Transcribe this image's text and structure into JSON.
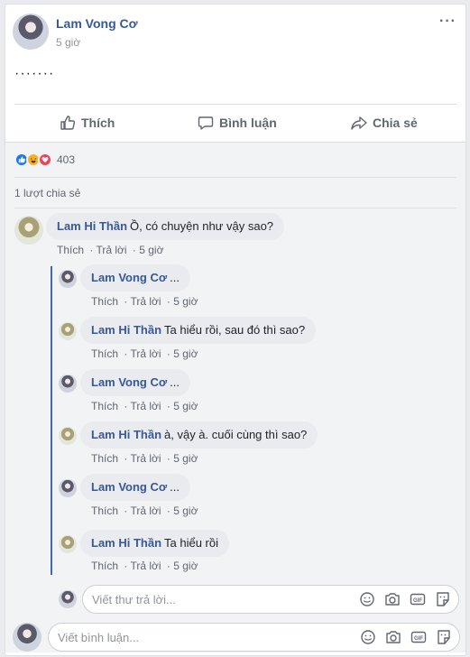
{
  "post": {
    "author": "Lam Vong Cơ",
    "time": "5 giờ",
    "more": "···",
    "text": "·······"
  },
  "actions": {
    "like": "Thích",
    "comment": "Bình luận",
    "share": "Chia sẻ"
  },
  "reactions": {
    "count": "403",
    "types": [
      "like-icon",
      "haha-icon",
      "love-icon"
    ]
  },
  "shares": "1 lượt chia sẻ",
  "comments": [
    {
      "author": "Lam Hi Thần",
      "text": "Ồ, có chuyện như vậy sao?",
      "like": "Thích",
      "reply": "Trả lời",
      "time": "5 giờ"
    },
    {
      "author": "Lam Vong Cơ",
      "text": "...",
      "like": "Thích",
      "reply": "Trả lời",
      "time": "5 giờ"
    },
    {
      "author": "Lam Hi Thần",
      "text": "Ta hiểu rồi, sau đó thì sao?",
      "like": "Thích",
      "reply": "Trả lời",
      "time": "5 giờ"
    },
    {
      "author": "Lam Vong Cơ",
      "text": "...",
      "like": "Thích",
      "reply": "Trả lời",
      "time": "5 giờ"
    },
    {
      "author": "Lam Hi Thần",
      "text": "à, vậy à. cuối cùng thì sao?",
      "like": "Thích",
      "reply": "Trả lời",
      "time": "5 giờ"
    },
    {
      "author": "Lam Vong Cơ",
      "text": "...",
      "like": "Thích",
      "reply": "Trả lời",
      "time": "5 giờ"
    },
    {
      "author": "Lam Hi Thần",
      "text": "Ta hiểu rồi",
      "like": "Thích",
      "reply": "Trả lời",
      "time": "5 giờ"
    }
  ],
  "reply_input": {
    "placeholder": "Viết thư trả lời..."
  },
  "comment_input": {
    "placeholder": "Viết bình luận..."
  },
  "colors": {
    "link": "#385898",
    "thread": "#4267b2",
    "like": "#1877f2",
    "love": "#f33e58",
    "haha": "#f7b125"
  }
}
